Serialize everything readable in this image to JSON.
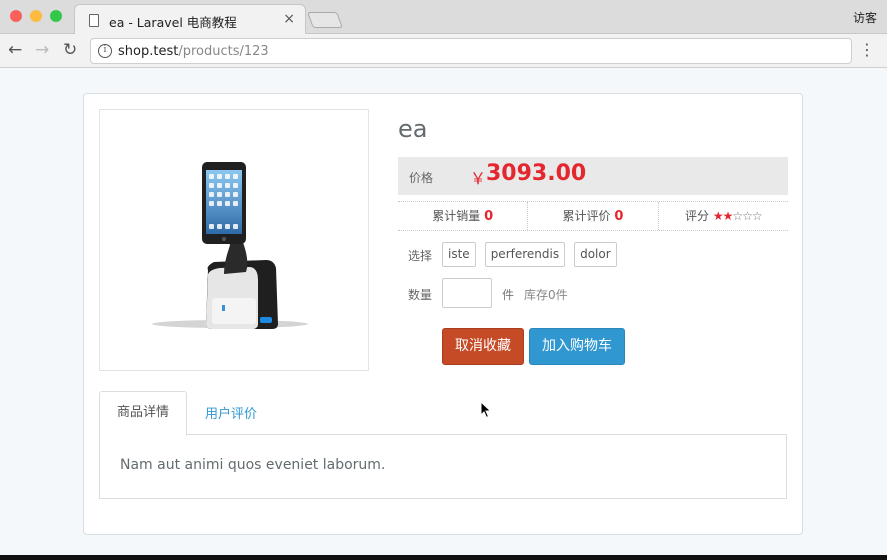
{
  "browser": {
    "tab_title": "ea - Laravel 电商教程",
    "tab_close": "×",
    "guest_label": "访客",
    "url_host": "shop.test",
    "url_path": "/products/123",
    "window_dots": [
      "#fc605c",
      "#fdbc40",
      "#34c84a"
    ]
  },
  "product": {
    "title": "ea",
    "price_label": "价格",
    "currency": "￥",
    "price": "3093.00",
    "sales_label": "累计销量",
    "sales_value": "0",
    "reviews_label": "累计评价",
    "reviews_value": "0",
    "rating_label": "评分",
    "rating_stars_filled": "★★",
    "rating_stars_empty": "☆☆☆",
    "rating_value": 2,
    "rating_max": 5,
    "select_label": "选择",
    "skus": [
      "iste",
      "perferendis",
      "dolor"
    ],
    "quantity_label": "数量",
    "quantity_value": "",
    "unit_label": "件",
    "stock_text": "库存0件",
    "unfavor_button": "取消收藏",
    "add_to_cart_button": "加入购物车",
    "image_icon": "kiosk-tablet-stand-image"
  },
  "tabs": {
    "details": "商品详情",
    "reviews": "用户评价",
    "active": "details"
  },
  "description": "Nam aut animi quos eveniet laborum.",
  "colors": {
    "price_red": "#e4262f",
    "unfavor_btn": "#c54b27",
    "cart_btn": "#3097d1",
    "link_blue": "#3097d1"
  }
}
